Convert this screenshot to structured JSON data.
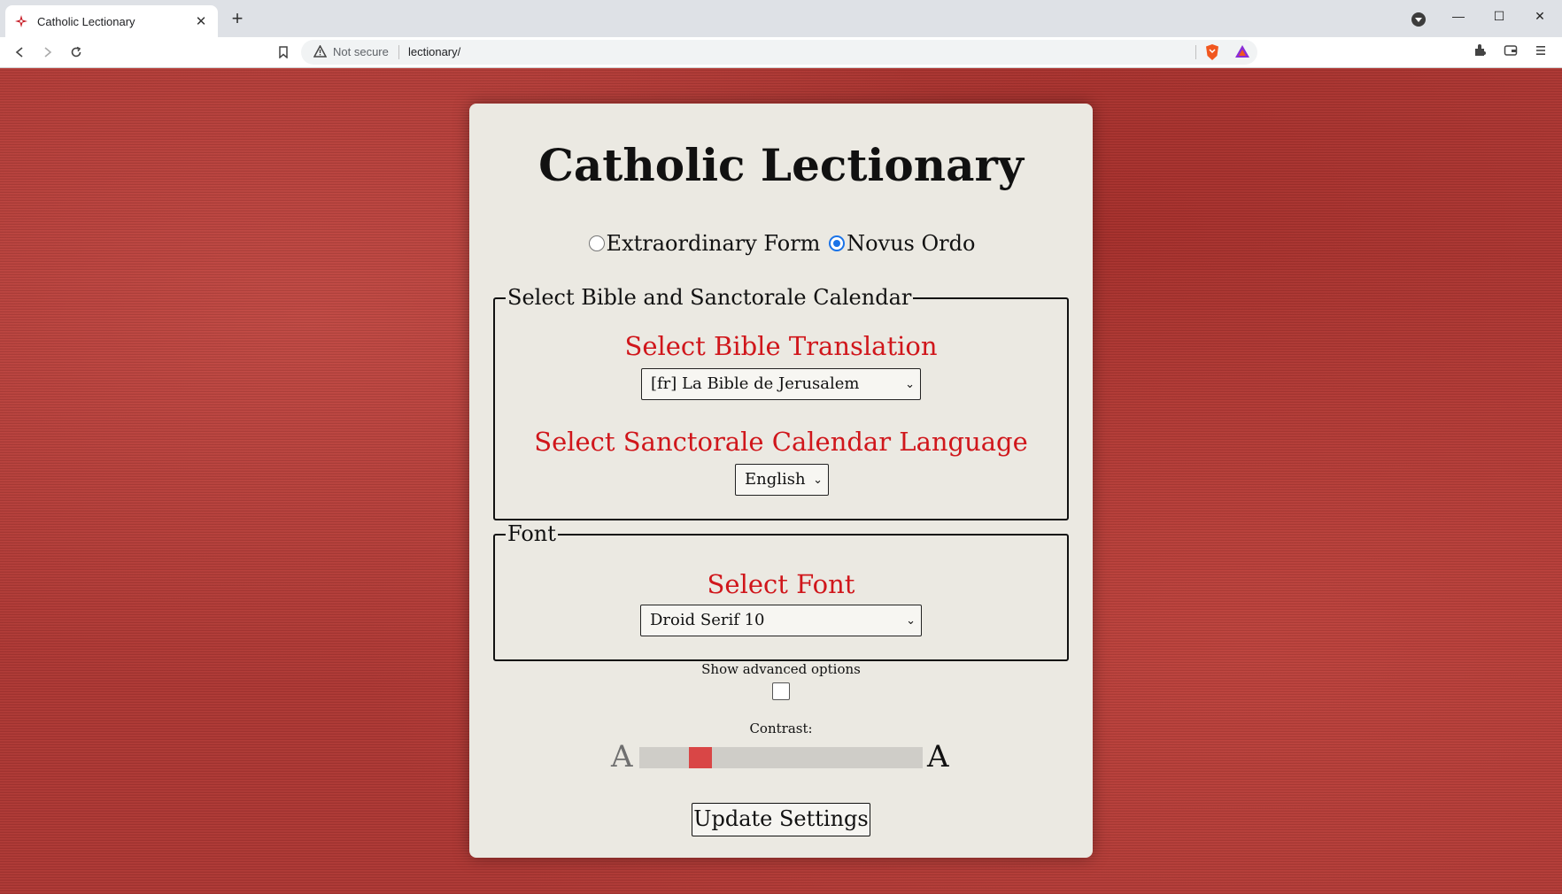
{
  "browser": {
    "tab_title": "Catholic Lectionary",
    "tab_close": "✕",
    "new_tab": "+",
    "window_minimize": "—",
    "window_maximize": "☐",
    "window_close": "✕",
    "security_label": "Not secure",
    "url": "lectionary/"
  },
  "page": {
    "title": "Catholic Lectionary",
    "form_options": [
      {
        "label": "Extraordinary Form",
        "selected": false
      },
      {
        "label": "Novus Ordo",
        "selected": true
      }
    ],
    "bible_calendar_fieldset": {
      "legend": "Select Bible and Sanctorale Calendar",
      "bible_heading": "Select Bible Translation",
      "bible_selected": "[fr] La Bible de Jerusalem",
      "calendar_heading": "Select Sanctorale Calendar Language",
      "calendar_selected": "English"
    },
    "font_fieldset": {
      "legend": "Font",
      "font_heading": "Select Font",
      "font_selected": "Droid Serif 10"
    },
    "advanced_label": "Show advanced options",
    "advanced_checked": false,
    "contrast_label": "Contrast:",
    "contrast_low_glyph": "A",
    "contrast_high_glyph": "A",
    "contrast_value": 0.19,
    "update_button": "Update Settings"
  },
  "colors": {
    "accent_red": "#d0161b",
    "slider_thumb": "#d94646",
    "radio_selected": "#1a73e8"
  }
}
